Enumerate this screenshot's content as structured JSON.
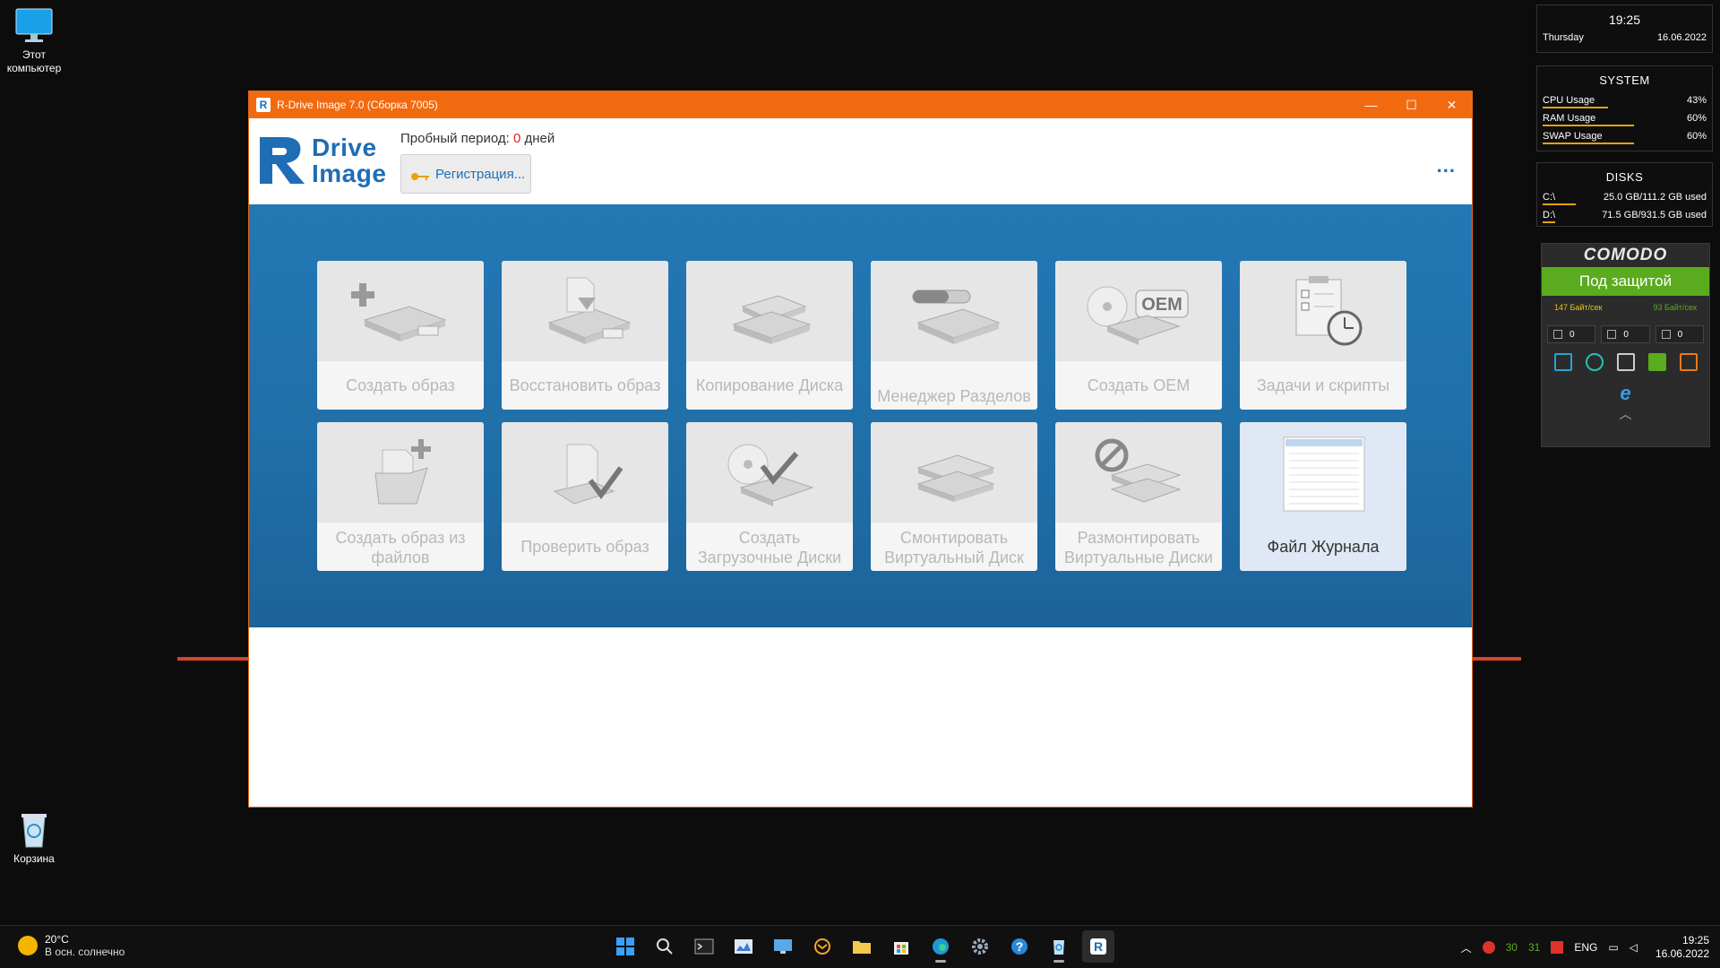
{
  "desktop": {
    "icons": [
      {
        "label": "Этот компьютер"
      },
      {
        "label": "Корзина"
      }
    ]
  },
  "window": {
    "title": "R-Drive Image 7.0 (Сборка 7005)",
    "logo_line1": "Drive",
    "logo_line2": "Image",
    "trial_prefix": "Пробный период:",
    "trial_days": "0",
    "trial_suffix": "дней",
    "register_button": "Регистрация...",
    "more_button": "...",
    "tiles": [
      {
        "label": "Создать образ",
        "icon": "create-image-icon"
      },
      {
        "label": "Восстановить образ",
        "icon": "restore-image-icon"
      },
      {
        "label": "Копирование Диска",
        "icon": "disk-copy-icon"
      },
      {
        "label": "Менеджер Разделов",
        "icon": "partition-manager-icon"
      },
      {
        "label": "Создать OEM",
        "icon": "oem-icon"
      },
      {
        "label": "Задачи и скрипты",
        "icon": "tasks-scripts-icon"
      },
      {
        "label": "Создать образ из файлов",
        "icon": "image-from-files-icon"
      },
      {
        "label": "Проверить образ",
        "icon": "check-image-icon"
      },
      {
        "label": "Создать Загрузочные Диски",
        "icon": "boot-disk-icon"
      },
      {
        "label": "Смонтировать Виртуальный Диск",
        "icon": "mount-virtual-disk-icon"
      },
      {
        "label": "Размонтировать Виртуальные Диски",
        "icon": "unmount-virtual-disk-icon"
      },
      {
        "label": "Файл Журнала",
        "icon": "log-file-icon"
      }
    ],
    "oem_text": "OEM"
  },
  "widgets": {
    "clock": {
      "time": "19:25",
      "day": "Thursday",
      "date": "16.06.2022"
    },
    "system": {
      "title": "SYSTEM",
      "rows": [
        {
          "name": "CPU Usage",
          "value": "43%",
          "level": 0.43
        },
        {
          "name": "RAM Usage",
          "value": "60%",
          "level": 0.6
        },
        {
          "name": "SWAP Usage",
          "value": "60%",
          "level": 0.6
        }
      ]
    },
    "disks": {
      "title": "DISKS",
      "rows": [
        {
          "name": "C:\\",
          "value": "25.0 GB/111.2 GB used",
          "level": 0.22
        },
        {
          "name": "D:\\",
          "value": "71.5 GB/931.5 GB used",
          "level": 0.08
        }
      ]
    },
    "comodo": {
      "brand": "COMODO",
      "status": "Под защитой",
      "rate_down": "147 Байт/сек",
      "rate_up": "93 Байт/сек",
      "counters": [
        "0",
        "0",
        "0"
      ],
      "colors": {
        "status_bg": "#5aab1e"
      }
    }
  },
  "taskbar": {
    "weather_temp": "20°C",
    "weather_desc": "В осн. солнечно",
    "apps": [
      "windows-start-icon",
      "search-icon",
      "terminal-icon",
      "monitor-app-icon",
      "remote-desktop-icon",
      "mail-icon",
      "file-explorer-icon",
      "store-icon",
      "edge-icon",
      "settings-icon",
      "help-icon",
      "recycle-app-icon",
      "rdrive-icon"
    ],
    "tray_nums": [
      "30",
      "31"
    ],
    "lang": "ENG",
    "time": "19:25",
    "date": "16.06.2022"
  }
}
